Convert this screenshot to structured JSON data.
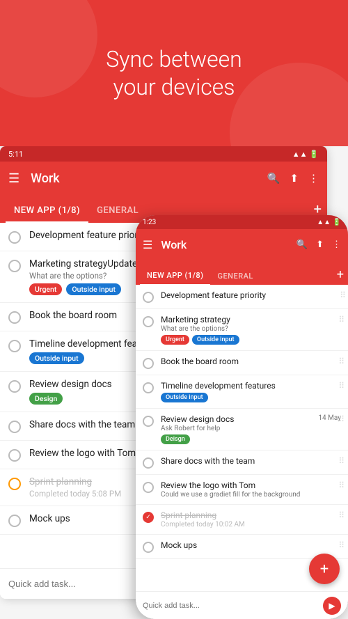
{
  "hero": {
    "line1": "Sync between",
    "line2": "your devices"
  },
  "tablet": {
    "status_time": "5:11",
    "header_title": "Work",
    "tab_new_app": "NEW APP (1/8)",
    "tab_general": "GENERAL",
    "tasks": [
      {
        "id": 1,
        "title": "Development feature priority",
        "subtitle": "",
        "tags": [],
        "radio": "empty",
        "completed": false
      },
      {
        "id": 2,
        "title": "Marketing strategy",
        "subtitle": "What are the options?",
        "tags": [
          "Urgent",
          "Outside input"
        ],
        "radio": "empty",
        "completed": false
      },
      {
        "id": 3,
        "title": "Book the board room",
        "subtitle": "",
        "tags": [],
        "radio": "empty",
        "completed": false
      },
      {
        "id": 4,
        "title": "Timeline development features",
        "subtitle": "",
        "tags": [
          "Outside input"
        ],
        "radio": "empty",
        "completed": false
      },
      {
        "id": 5,
        "title": "Review design docs",
        "subtitle": "",
        "tags": [
          "Design"
        ],
        "radio": "empty",
        "completed": false
      },
      {
        "id": 6,
        "title": "Share docs with the team",
        "subtitle": "",
        "tags": [],
        "radio": "empty",
        "completed": false
      },
      {
        "id": 7,
        "title": "Review the logo with Tom",
        "subtitle": "",
        "tags": [],
        "radio": "empty",
        "completed": false
      },
      {
        "id": 8,
        "title": "Sprint planning",
        "subtitle": "Completed today 5:08 PM",
        "tags": [],
        "radio": "orange",
        "completed": true
      },
      {
        "id": 9,
        "title": "Mock ups",
        "subtitle": "",
        "tags": [],
        "radio": "empty",
        "completed": false
      }
    ],
    "quick_add_placeholder": "Quick add task..."
  },
  "phone": {
    "status_time": "1:23",
    "header_title": "Work",
    "tab_new_app": "NEW APP (1/8)",
    "tab_general": "GENERAL",
    "tasks": [
      {
        "id": 1,
        "title": "Development feature priority",
        "subtitle": "",
        "tags": [],
        "radio": "empty",
        "completed": false
      },
      {
        "id": 2,
        "title": "Marketing strategy",
        "subtitle": "What are the options?",
        "tags": [
          "Urgent",
          "Outside input"
        ],
        "radio": "empty",
        "completed": false
      },
      {
        "id": 3,
        "title": "Book the board room",
        "subtitle": "",
        "tags": [],
        "radio": "empty",
        "completed": false
      },
      {
        "id": 4,
        "title": "Timeline development features",
        "subtitle": "",
        "tags": [
          "Outside input"
        ],
        "radio": "empty",
        "completed": false
      },
      {
        "id": 5,
        "title": "Review design docs",
        "subtitle": "Ask Robert for help",
        "date": "14 May",
        "tags": [
          "Deisgn"
        ],
        "radio": "empty",
        "completed": false
      },
      {
        "id": 6,
        "title": "Share docs with the team",
        "subtitle": "",
        "tags": [],
        "radio": "empty",
        "completed": false
      },
      {
        "id": 7,
        "title": "Review the logo with Tom",
        "subtitle": "Could we use a gradiet fill for the background",
        "tags": [],
        "radio": "empty",
        "completed": false
      },
      {
        "id": 8,
        "title": "Sprint planning",
        "subtitle": "Completed today 10:02 AM",
        "tags": [],
        "radio": "checked",
        "completed": true
      },
      {
        "id": 9,
        "title": "Mock ups",
        "subtitle": "",
        "tags": [],
        "radio": "empty",
        "completed": false
      }
    ],
    "quick_add_placeholder": "Quick add task...",
    "fab_label": "+"
  },
  "icons": {
    "menu": "☰",
    "search": "🔍",
    "share": "⬆",
    "more": "⋮",
    "send": "▶",
    "drag": "⠿",
    "chevron_up": "∧",
    "check": "✓"
  }
}
